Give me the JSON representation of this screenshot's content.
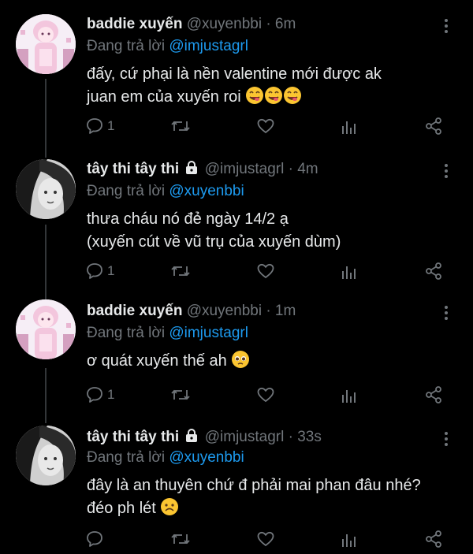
{
  "tweets": [
    {
      "name": "baddie xuyến",
      "handle": "@xuyenbbi",
      "time": "· 6m",
      "reply_prefix": "Đang trả lời",
      "reply_to": "@imjustagrl",
      "lines": [
        "đấy, cứ phại là nền valentine mới được ak",
        "juan em của xuyến roi"
      ],
      "emoji": "yum-emoji x3",
      "reply_count": "1",
      "locked": false
    },
    {
      "name": "tây thi tây thi",
      "handle": "@imjustagrl",
      "time": "· 4m",
      "reply_prefix": "Đang trả lời",
      "reply_to": "@xuyenbbi",
      "lines": [
        "thưa cháu nó đẻ ngày 14/2 ạ",
        "(xuyến cút về vũ trụ của xuyến dùm)"
      ],
      "reply_count": "1",
      "locked": true
    },
    {
      "name": "baddie xuyến",
      "handle": "@xuyenbbi",
      "time": "· 1m",
      "reply_prefix": "Đang trả lời",
      "reply_to": "@imjustagrl",
      "lines": [
        "ơ quát xuyến thế ah"
      ],
      "emoji": "pleading-emoji",
      "reply_count": "1",
      "locked": false
    },
    {
      "name": "tây thi tây thi",
      "handle": "@imjustagrl",
      "time": "· 33s",
      "reply_prefix": "Đang trả lời",
      "reply_to": "@xuyenbbi",
      "lines": [
        "đây là an thuyên chứ đ phải mai phan đâu nhé?",
        "đéo ph lét"
      ],
      "emoji": "frowning-emoji",
      "reply_count": "",
      "locked": true
    }
  ],
  "colors": {
    "background": "#000000",
    "text": "#e7e9ea",
    "muted": "#71767b",
    "link": "#1d9bf0"
  }
}
